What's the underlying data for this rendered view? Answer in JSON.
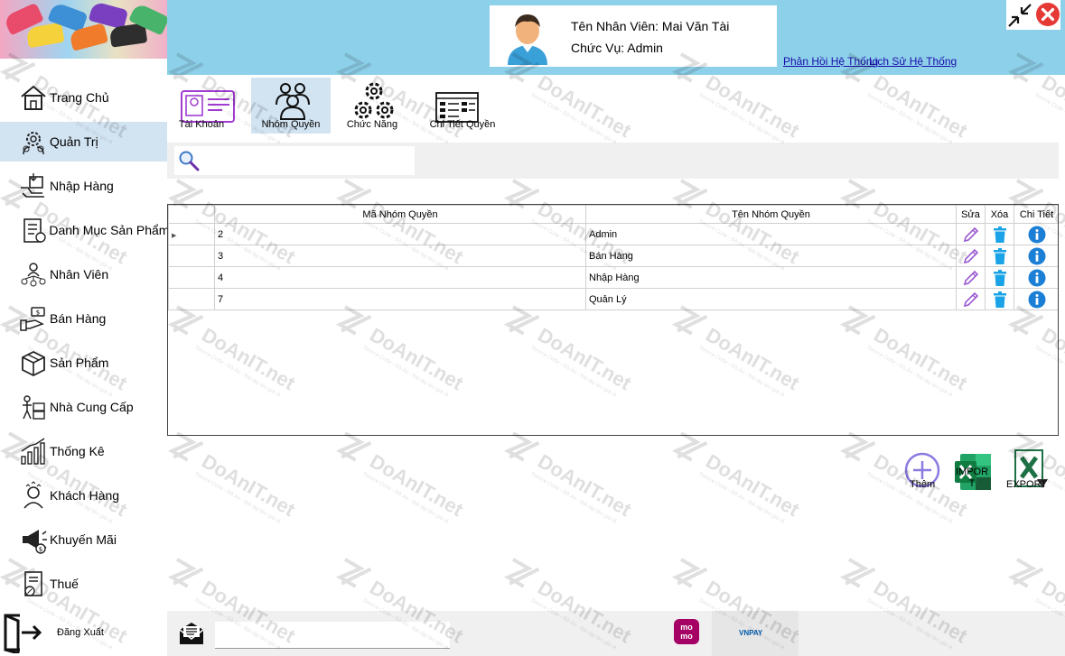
{
  "colors": {
    "header_bg": "#8dd0ea",
    "active_bg": "#d2e3f2",
    "link": "#1a0dab",
    "edit_icon": "#9b59d0",
    "delete_icon": "#1aa3e6",
    "info_icon": "#1c7fd6",
    "close_button": "#e53935"
  },
  "sidebar": {
    "items": [
      {
        "label": "Trang Chủ",
        "icon": "home-icon"
      },
      {
        "label": "Quản Trị",
        "icon": "admin-gears-icon",
        "active": true
      },
      {
        "label": "Nhập Hàng",
        "icon": "import-goods-icon"
      },
      {
        "label": "Danh Mục Sản Phẩm",
        "icon": "product-catalog-icon"
      },
      {
        "label": "Nhân Viên",
        "icon": "staff-icon"
      },
      {
        "label": "Bán Hàng",
        "icon": "sales-icon"
      },
      {
        "label": "Sản Phẩm",
        "icon": "box-icon"
      },
      {
        "label": "Nhà Cung Cấp",
        "icon": "supplier-icon"
      },
      {
        "label": "Thống Kê",
        "icon": "statistics-icon"
      },
      {
        "label": "Khách Hàng",
        "icon": "customer-icon"
      },
      {
        "label": "Khuyến Mãi",
        "icon": "promotion-icon"
      },
      {
        "label": "Thuế",
        "icon": "tax-icon"
      }
    ],
    "logout_label": "Đăng Xuất"
  },
  "header": {
    "employee_line": "Tên Nhân Viên: Mai Văn Tài",
    "role_line": "Chức Vụ: Admin",
    "feedback_link": "Phản Hồi Hệ Thống",
    "history_link": "Lịch Sử Hệ Thống"
  },
  "tabs": [
    {
      "label": "Tài Khoản",
      "icon": "account-card-icon"
    },
    {
      "label": "Nhóm Quyền",
      "icon": "user-group-icon",
      "active": true
    },
    {
      "label": "Chức Năng",
      "icon": "functions-gears-icon"
    },
    {
      "label": "Chi Tiết Quyền",
      "icon": "permission-detail-icon"
    }
  ],
  "search": {
    "value": "",
    "placeholder": ""
  },
  "grid": {
    "columns": [
      "Mã Nhóm Quyền",
      "Tên Nhóm Quyền",
      "Sửa",
      "Xóa",
      "Chi Tiết"
    ],
    "rows": [
      {
        "id": "2",
        "name": "Admin"
      },
      {
        "id": "3",
        "name": "Bán Hàng"
      },
      {
        "id": "4",
        "name": "Nhập Hàng"
      },
      {
        "id": "7",
        "name": "Quản Lý"
      }
    ]
  },
  "actions": {
    "add_label": "Thêm",
    "import_label": "IMPORT",
    "export_label": "EXPORT"
  },
  "footer": {
    "message_value": "",
    "momo_label": "mo mo",
    "vnpay_label": "VNPAY"
  },
  "watermark": {
    "brand": "DoAnIT.net",
    "tagline": "Source Code - Đồ Án - Bài tập lớn giá rẻ"
  }
}
